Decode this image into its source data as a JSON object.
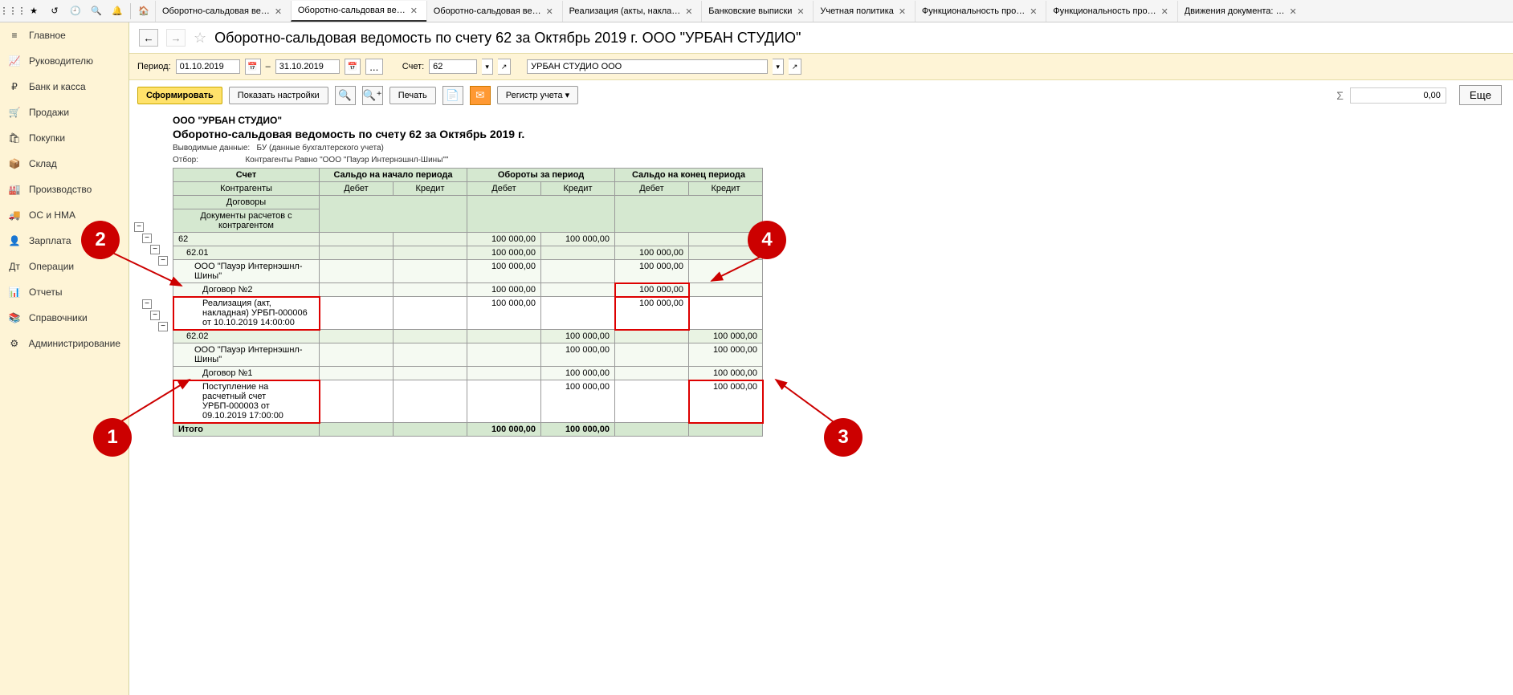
{
  "toolbar_icons": [
    "grid",
    "star",
    "back",
    "history",
    "search",
    "bell"
  ],
  "tabs": [
    {
      "label": "Оборотно-сальдовая ве…",
      "active": false
    },
    {
      "label": "Оборотно-сальдовая ве…",
      "active": true
    },
    {
      "label": "Оборотно-сальдовая ве…",
      "active": false
    },
    {
      "label": "Реализация (акты, накла…",
      "active": false
    },
    {
      "label": "Банковские выписки",
      "active": false
    },
    {
      "label": "Учетная политика",
      "active": false
    },
    {
      "label": "Функциональность про…",
      "active": false
    },
    {
      "label": "Функциональность про…",
      "active": false
    },
    {
      "label": "Движения документа: …",
      "active": false
    }
  ],
  "sidebar": [
    {
      "icon": "≡",
      "label": "Главное"
    },
    {
      "icon": "📈",
      "label": "Руководителю"
    },
    {
      "icon": "₽",
      "label": "Банк и касса"
    },
    {
      "icon": "🛒",
      "label": "Продажи"
    },
    {
      "icon": "🛍",
      "label": "Покупки"
    },
    {
      "icon": "📦",
      "label": "Склад"
    },
    {
      "icon": "🏭",
      "label": "Производство"
    },
    {
      "icon": "🚚",
      "label": "ОС и НМА"
    },
    {
      "icon": "👤",
      "label": "Зарплата"
    },
    {
      "icon": "Дт",
      "label": "Операции"
    },
    {
      "icon": "📊",
      "label": "Отчеты"
    },
    {
      "icon": "📚",
      "label": "Справочники"
    },
    {
      "icon": "⚙",
      "label": "Администрирование"
    }
  ],
  "page_title": "Оборотно-сальдовая ведомость по счету 62 за Октябрь 2019 г. ООО \"УРБАН СТУДИО\"",
  "filters": {
    "period_label": "Период:",
    "date_from": "01.10.2019",
    "date_sep": "–",
    "date_to": "31.10.2019",
    "ellipsis": "...",
    "account_label": "Счет:",
    "account_value": "62",
    "org_value": "УРБАН СТУДИО ООО"
  },
  "actions": {
    "form": "Сформировать",
    "settings": "Показать настройки",
    "print": "Печать",
    "register": "Регистр учета ▾",
    "sum_value": "0,00",
    "more": "Еще"
  },
  "report": {
    "company": "ООО \"УРБАН СТУДИО\"",
    "title": "Оборотно-сальдовая ведомость по счету 62 за Октябрь 2019 г.",
    "meta_output_label": "Выводимые данные:",
    "meta_output_value": "БУ (данные бухгалтерского учета)",
    "meta_filter_label": "Отбор:",
    "meta_filter_value": "Контрагенты Равно \"ООО \"Пауэр Интернэшнл-Шины\"\"",
    "head_account": "Счет",
    "head_saldo_start": "Сальдо на начало периода",
    "head_turnover": "Обороты за период",
    "head_saldo_end": "Сальдо на конец периода",
    "head_counterparties": "Контрагенты",
    "head_debit": "Дебет",
    "head_credit": "Кредит",
    "head_contracts": "Договоры",
    "head_docs": "Документы расчетов с контрагентом",
    "rows": [
      {
        "type": "acct",
        "label": "62",
        "values": [
          "",
          "",
          "100 000,00",
          "100 000,00",
          "",
          ""
        ]
      },
      {
        "type": "acct",
        "indent": 1,
        "label": "62.01",
        "values": [
          "",
          "",
          "100 000,00",
          "",
          "100 000,00",
          ""
        ]
      },
      {
        "type": "sub",
        "indent": 2,
        "label": "ООО \"Пауэр Интернэшнл-Шины\"",
        "values": [
          "",
          "",
          "100 000,00",
          "",
          "100 000,00",
          ""
        ]
      },
      {
        "type": "sub",
        "indent": 3,
        "label": "Договор №2",
        "values": [
          "",
          "",
          "100 000,00",
          "",
          "100 000,00",
          ""
        ],
        "hl_se_d": true
      },
      {
        "type": "doc",
        "indent": 4,
        "label": "Реализация (акт, накладная) УРБП-000006 от 10.10.2019 14:00:00",
        "values": [
          "",
          "",
          "100 000,00",
          "",
          "100 000,00",
          ""
        ],
        "hl_label": true,
        "hl_se_d": true
      },
      {
        "type": "acct",
        "indent": 1,
        "label": "62.02",
        "values": [
          "",
          "",
          "",
          "100 000,00",
          "",
          "100 000,00"
        ]
      },
      {
        "type": "sub",
        "indent": 2,
        "label": "ООО \"Пауэр Интернэшнл-Шины\"",
        "values": [
          "",
          "",
          "",
          "100 000,00",
          "",
          "100 000,00"
        ]
      },
      {
        "type": "sub",
        "indent": 3,
        "label": "Договор №1",
        "values": [
          "",
          "",
          "",
          "100 000,00",
          "",
          "100 000,00"
        ]
      },
      {
        "type": "doc",
        "indent": 4,
        "label": "Поступление на расчетный счет УРБП-000003 от 09.10.2019 17:00:00",
        "values": [
          "",
          "",
          "",
          "100 000,00",
          "",
          "100 000,00"
        ],
        "hl_label": true,
        "hl_se_k": true
      }
    ],
    "total_label": "Итого",
    "total_values": [
      "",
      "",
      "100 000,00",
      "100 000,00",
      "",
      ""
    ]
  },
  "callouts": {
    "c1": "1",
    "c2": "2",
    "c3": "3",
    "c4": "4"
  }
}
